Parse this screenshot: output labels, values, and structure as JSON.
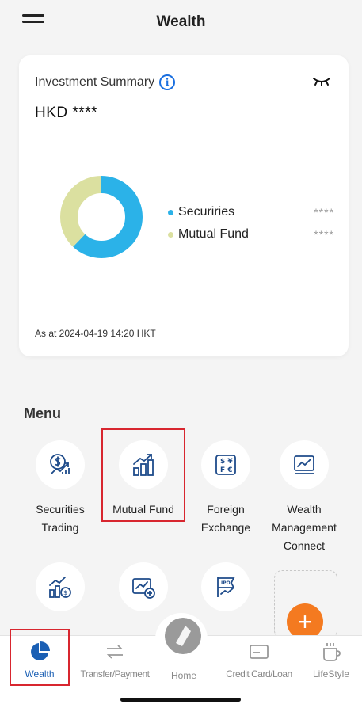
{
  "header": {
    "title": "Wealth"
  },
  "summary": {
    "title": "Investment Summary",
    "currency": "HKD",
    "masked_amount": "****",
    "as_at": "As at 2024-04-19 14:20 HKT",
    "legend": [
      {
        "label": "Securiries",
        "value": "****",
        "color": "#2bb2e8"
      },
      {
        "label": "Mutual Fund",
        "value": "****",
        "color": "#dbe0a0"
      }
    ],
    "chart_data": {
      "type": "pie",
      "categories": [
        "Securiries",
        "Mutual Fund"
      ],
      "values": [
        62,
        38
      ]
    }
  },
  "menu": {
    "title": "Menu",
    "items": [
      {
        "label": "Securities Trading",
        "line1": "Securities",
        "line2": "Trading",
        "line3": "",
        "icon": "securities-trading-icon"
      },
      {
        "label": "Mutual Fund",
        "line1": "Mutual Fund",
        "line2": "",
        "line3": "",
        "icon": "mutual-fund-icon"
      },
      {
        "label": "Foreign Exchange",
        "line1": "Foreign",
        "line2": "Exchange",
        "line3": "",
        "icon": "foreign-exchange-icon"
      },
      {
        "label": "Wealth Management Connect",
        "line1": "Wealth",
        "line2": "Management",
        "line3": "Connect",
        "icon": "wealth-connect-icon"
      }
    ],
    "second_row_icons": [
      "growth-coin-icon",
      "chart-add-icon",
      "ipo-icon"
    ]
  },
  "bottom_nav": {
    "items": [
      {
        "label": "Wealth",
        "active": true
      },
      {
        "label": "Transfer/Payment",
        "active": false
      },
      {
        "label": "Home",
        "active": false
      },
      {
        "label": "Credit Card/Loan",
        "active": false
      },
      {
        "label": "LifeStyle",
        "active": false
      }
    ]
  },
  "colors": {
    "accent": "#1a5fb4",
    "highlight": "#d8262f",
    "add_button": "#f47a20",
    "icon_stroke": "#1e4b8a"
  }
}
